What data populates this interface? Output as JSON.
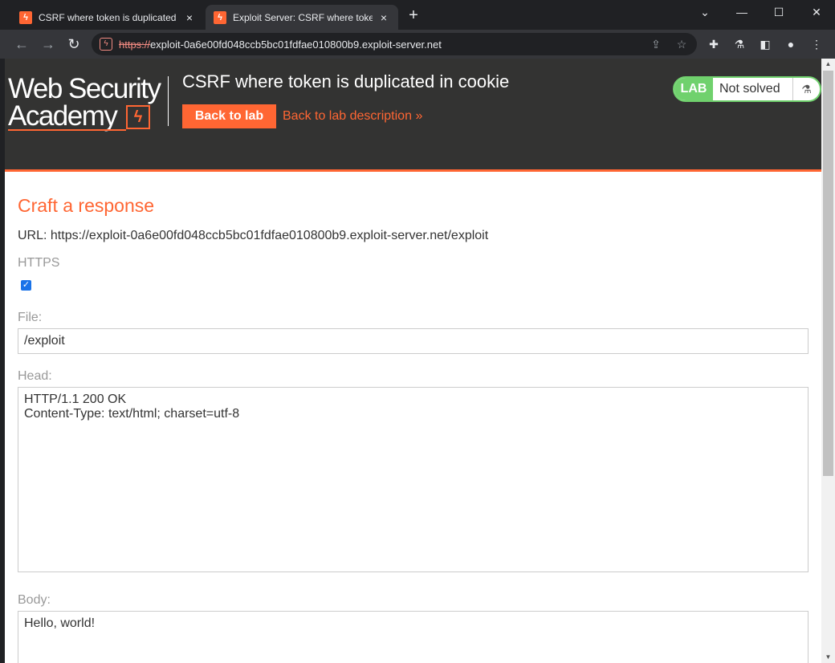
{
  "browser": {
    "tabs": [
      {
        "title": "CSRF where token is duplicated in",
        "close": "×"
      },
      {
        "title": "Exploit Server: CSRF where token",
        "close": "×"
      }
    ],
    "new_tab": "+",
    "controls": {
      "minimize": "—",
      "maximize": "☐",
      "close": "✕",
      "dropdown": "⌄"
    },
    "address": {
      "scheme": "https://",
      "rest": "exploit-0a6e00fd048ccb5bc01fdfae010800b9.exploit-server.net"
    }
  },
  "header": {
    "logo_line1": "Web Security",
    "logo_line2": "Academy",
    "lab_title": "CSRF where token is duplicated in cookie",
    "back_to_lab": "Back to lab",
    "back_to_description": "Back to lab description",
    "back_chevrons": "»",
    "status_badge": "LAB",
    "status_text": "Not solved"
  },
  "form": {
    "heading": "Craft a response",
    "url_line": "URL: https://exploit-0a6e00fd048ccb5bc01fdfae010800b9.exploit-server.net/exploit",
    "https_label": "HTTPS",
    "https_checked": true,
    "file_label": "File:",
    "file_value": "/exploit",
    "head_label": "Head:",
    "head_value": "HTTP/1.1 200 OK\nContent-Type: text/html; charset=utf-8",
    "body_label": "Body:",
    "body_value": "Hello, world!"
  },
  "colors": {
    "accent": "#ff6633",
    "header_bg": "#333332",
    "lab_green": "#70d16d"
  }
}
